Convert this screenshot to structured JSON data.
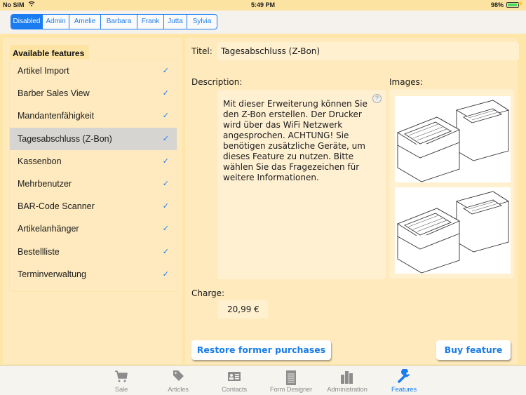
{
  "status_bar": {
    "carrier": "No SIM",
    "time": "5:49 PM",
    "battery_percent": "98%",
    "icons": [
      "wifi-icon",
      "battery-icon",
      "charging-icon"
    ]
  },
  "user_segments": {
    "items": [
      {
        "label": "Disabled",
        "selected": true
      },
      {
        "label": "Admin",
        "selected": false
      },
      {
        "label": "Amelie",
        "selected": false
      },
      {
        "label": "Barbara",
        "selected": false
      },
      {
        "label": "Frank",
        "selected": false
      },
      {
        "label": "Jutta",
        "selected": false
      },
      {
        "label": "Sylvia",
        "selected": false
      }
    ]
  },
  "features_panel": {
    "title": "Available features",
    "items": [
      {
        "label": "Artikel Import",
        "checked": true,
        "selected": false
      },
      {
        "label": "Barber Sales View",
        "checked": true,
        "selected": false
      },
      {
        "label": "Mandantenfähigkeit",
        "checked": true,
        "selected": false
      },
      {
        "label": "Tagesabschluss (Z-Bon)",
        "checked": true,
        "selected": true
      },
      {
        "label": "Kassenbon",
        "checked": true,
        "selected": false
      },
      {
        "label": "Mehrbenutzer",
        "checked": true,
        "selected": false
      },
      {
        "label": "BAR-Code Scanner",
        "checked": true,
        "selected": false
      },
      {
        "label": "Artikelanhänger",
        "checked": true,
        "selected": false
      },
      {
        "label": "Bestellliste",
        "checked": true,
        "selected": false
      },
      {
        "label": "Terminverwaltung",
        "checked": true,
        "selected": false
      }
    ],
    "check_glyph": "✓"
  },
  "detail": {
    "title_label": "Titel:",
    "title_value": "Tagesabschluss (Z-Bon)",
    "description_label": "Description:",
    "description_text": "Mit dieser Erweiterung können Sie den Z-Bon erstellen. Der Drucker wird über das WiFi Netzwerk angesprochen. ACHTUNG! Sie benötigen zusätzliche Geräte, um dieses Feature zu nutzen. Bitte wählen Sie das Fragezeichen für weitere Informationen.",
    "help_glyph": "?",
    "images_label": "Images:",
    "images": [
      {
        "alt": "receipt-printer-image"
      },
      {
        "alt": "receipt-printer-image"
      }
    ],
    "charge_label": "Charge:",
    "charge_value": "20,99 €",
    "restore_button": "Restore former purchases",
    "buy_button": "Buy feature"
  },
  "tab_bar": {
    "tabs": [
      {
        "label": "Sale",
        "icon": "cart-icon",
        "active": false
      },
      {
        "label": "Articles",
        "icon": "tag-icon",
        "active": false
      },
      {
        "label": "Contacts",
        "icon": "contact-card-icon",
        "active": false
      },
      {
        "label": "Form Designer",
        "icon": "notepad-icon",
        "active": false
      },
      {
        "label": "Administration",
        "icon": "buildings-icon",
        "active": false
      },
      {
        "label": "Features",
        "icon": "wrench-icon",
        "active": true
      }
    ]
  },
  "colors": {
    "accent": "#1a7cf0",
    "background": "#feeabd",
    "selected_row": "#d6d5d2"
  }
}
